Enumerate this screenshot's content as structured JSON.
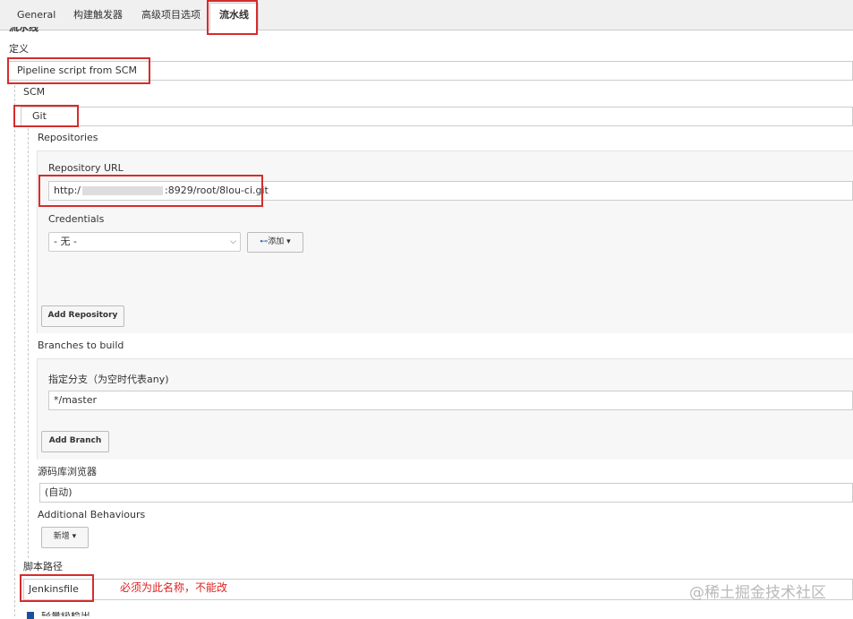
{
  "tabs": [
    {
      "label": "General"
    },
    {
      "label": "构建触发器"
    },
    {
      "label": "高级项目选项"
    },
    {
      "label": "流水线"
    }
  ],
  "section_title": "流水线",
  "definition": {
    "label": "定义",
    "value": "Pipeline script from SCM"
  },
  "scm": {
    "label": "SCM",
    "value": "Git"
  },
  "repositories": {
    "label": "Repositories",
    "url_label": "Repository URL",
    "url_prefix": "http:/",
    "url_suffix": ":8929/root/8lou-ci.git",
    "credentials_label": "Credentials",
    "credentials_value": "- 无 -",
    "add_label": "添加",
    "add_repository_label": "Add Repository"
  },
  "branches": {
    "label": "Branches to build",
    "branch_label": "指定分支（为空时代表any)",
    "branch_value": "*/master",
    "add_branch_label": "Add Branch"
  },
  "browser": {
    "label": "源码库浏览器",
    "value": "(自动)"
  },
  "additional": {
    "label": "Additional Behaviours",
    "add_label": "新增"
  },
  "script_path": {
    "label": "脚本路径",
    "value": "Jenkinsfile",
    "note": "必须为此名称，不能改"
  },
  "lightweight_label": "轻量级检出",
  "watermark": "@稀土掘金技术社区",
  "colors": {
    "annotation": "#d62c2c",
    "panel": "#f7f7f7"
  }
}
